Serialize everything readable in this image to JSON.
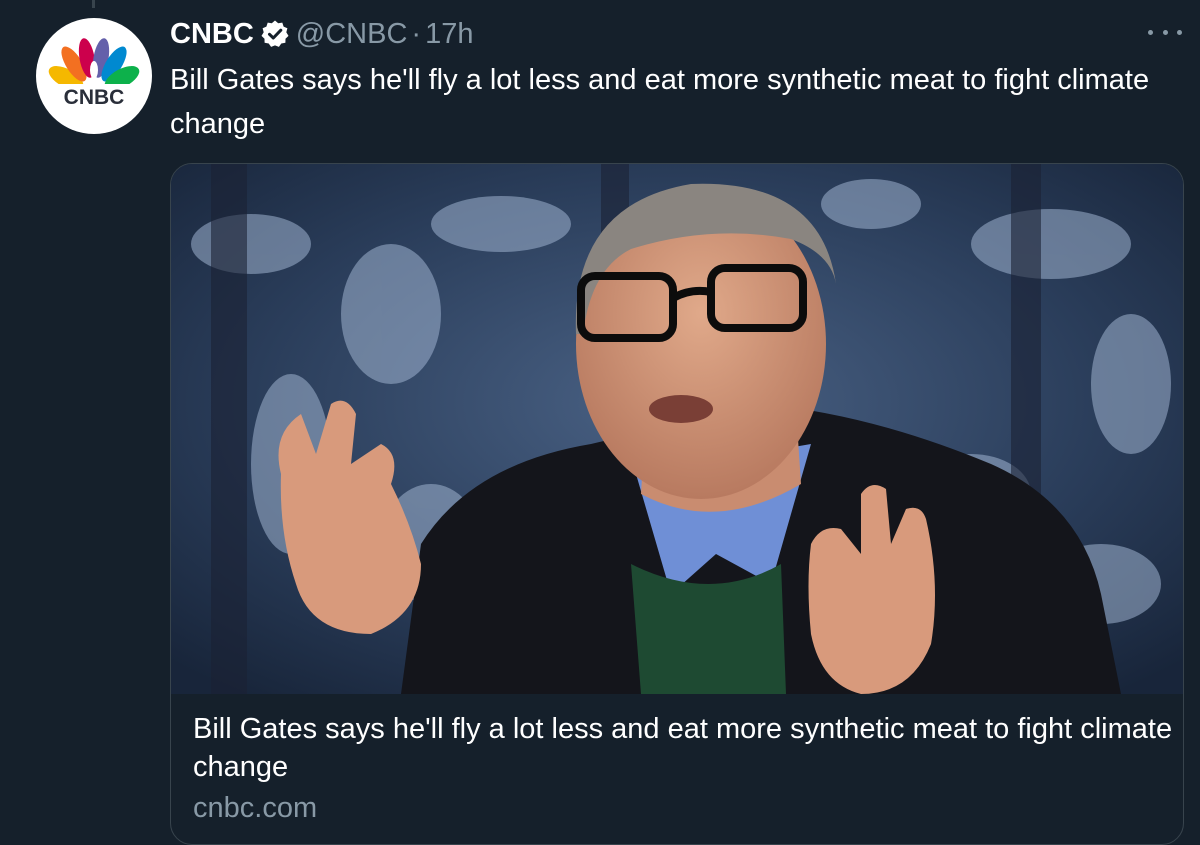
{
  "tweet": {
    "author_name": "CNBC",
    "handle": "@CNBC",
    "separator": "·",
    "time": "17h",
    "text": "Bill Gates says he'll fly a lot less and eat more synthetic meat to fight climate change",
    "verified_icon": "verified-badge-icon",
    "more_icon": "more-options-icon"
  },
  "avatar": {
    "logo_text": "CNBC",
    "logo_icon": "nbc-peacock-icon",
    "peacock_colors": [
      "#f5b800",
      "#f37021",
      "#cc004c",
      "#6460aa",
      "#0089d0",
      "#0db14b"
    ]
  },
  "card": {
    "title": "Bill Gates says he'll fly a lot less and eat more synthetic meat to fight climate change",
    "domain": "cnbc.com",
    "image_description_icon": "article-photo"
  },
  "colors": {
    "background": "#15202b",
    "secondary_text": "#8899a6",
    "border": "#38444d",
    "verified_blue": "#ffffff"
  }
}
